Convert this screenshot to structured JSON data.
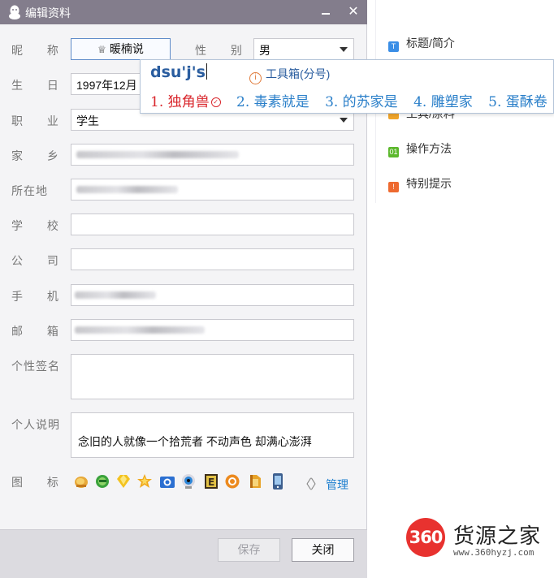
{
  "window": {
    "title": "编辑资料",
    "minimize_glyph": "—",
    "close_glyph": "✕"
  },
  "form": {
    "nickname": {
      "label": "昵 称",
      "value": "暖楠说",
      "icon": "crown-icon"
    },
    "gender": {
      "label": "性 别",
      "value": "男"
    },
    "birthday": {
      "label": "生 日",
      "value": "1997年12月"
    },
    "job": {
      "label": "职 业",
      "value": "学生"
    },
    "hometown": {
      "label": "家 乡"
    },
    "location": {
      "label": "所在地"
    },
    "school": {
      "label": "学 校",
      "value": ""
    },
    "company": {
      "label": "公 司",
      "value": ""
    },
    "phone": {
      "label": "手 机"
    },
    "email": {
      "label": "邮 箱"
    },
    "signature": {
      "label": "个性签名",
      "value": ""
    },
    "description": {
      "label": "个人说明",
      "value": "念旧的人就像一个拾荒者 不动声色 却满心澎湃"
    },
    "badges": {
      "label": "图 标",
      "icons": [
        "hand-icon",
        "green-face-icon",
        "diamond-icon",
        "star-icon",
        "camera-icon",
        "eye-icon",
        "book-icon",
        "gold-coin-icon",
        "shield-icon",
        "phone-badge-icon"
      ],
      "prev": "〈",
      "next": "〉",
      "manage": "管理"
    }
  },
  "footer": {
    "save": "保存",
    "close": "关闭"
  },
  "side_panel": {
    "items": [
      {
        "label": "标题/简介",
        "badge": "T",
        "color": "#3a8ee6"
      },
      {
        "label": "工具/原料",
        "badge": "",
        "color": "#f0a52a"
      },
      {
        "label": "操作方法",
        "badge": "01",
        "color": "#5cb82d"
      },
      {
        "label": "特别提示",
        "badge": "!",
        "color": "#ee6a30"
      }
    ]
  },
  "ime": {
    "composition": "dsu'j's",
    "toolbox": "工具箱(分号)",
    "candidates": [
      "1. 独角兽",
      "2. 毒素就是",
      "3. 的苏家是",
      "4. 雕塑家",
      "5. 蛋酥卷"
    ]
  },
  "watermark": {
    "badge": "360",
    "name": "货源之家",
    "url": "www.360hyzj.com"
  }
}
